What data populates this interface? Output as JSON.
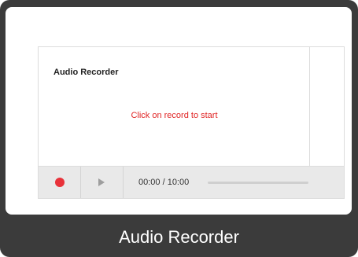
{
  "widget": {
    "title": "Audio Recorder",
    "status_text": "Click on record to start",
    "status_color": "#e02424"
  },
  "controls": {
    "record_icon": "record-icon",
    "record_color": "#e8323a",
    "play_icon": "play-icon",
    "time_display": "00:00 / 10:00",
    "progress": 0
  },
  "caption": {
    "text": "Audio Recorder"
  }
}
